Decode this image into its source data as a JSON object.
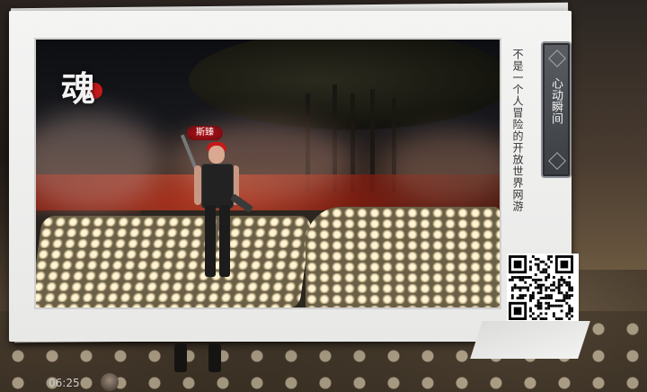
{
  "game": {
    "logo_char": "魂"
  },
  "player": {
    "name": "斯臻"
  },
  "card": {
    "tagline": "不是一个人冒险的开放世界网游",
    "badge_text": "心动瞬间",
    "qr_code": "qr-code"
  },
  "hud": {
    "clock": "06:25"
  },
  "colors": {
    "accent_red": "#c41a1a",
    "badge_grey": "#4a4d52",
    "card_white": "#f0f0ef"
  }
}
